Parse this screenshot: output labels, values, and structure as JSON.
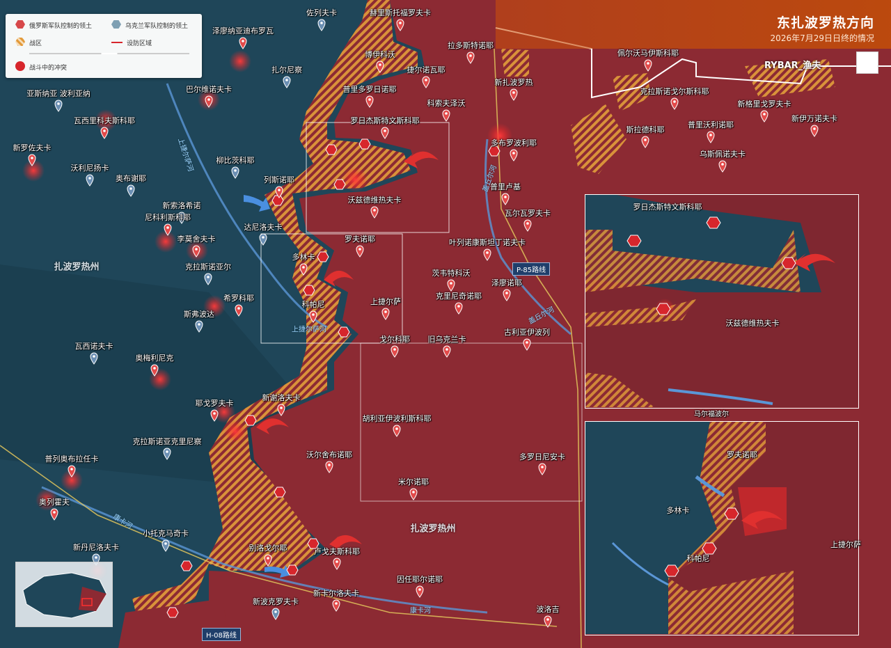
{
  "header": {
    "title": "东扎波罗热方向",
    "subtitle": "2026年7月29日日终的情况",
    "brand": "RYBAR_渔夫"
  },
  "legend": {
    "russian_control": "俄罗斯军队控制的领土",
    "ukrainian_control": "乌克兰军队控制的领土",
    "battle_zone": "战区",
    "defense_area": "设防区域",
    "clash": "战斗中的冲突"
  },
  "colors": {
    "russian": "#8c2a33",
    "ukrainian": "#1f4659",
    "battle_zone": "#d9923a",
    "clash": "#d7262c",
    "title_bg": "#c8500e"
  },
  "regions": [
    {
      "text": "扎波罗热州"
    },
    {
      "text": "扎波罗热州"
    }
  ],
  "rivers": [
    {
      "text": "上捷尔萨河"
    },
    {
      "text": "上捷尔萨河"
    },
    {
      "text": "盖丘尔河"
    },
    {
      "text": "盖丘尔河"
    },
    {
      "text": "康卡河"
    },
    {
      "text": "康卡河"
    }
  ],
  "roads": [
    {
      "text": "P-85路线"
    },
    {
      "text": "H-08路线"
    }
  ],
  "places": [
    {
      "name": "佐列夫卡"
    },
    {
      "name": "赫里斯托福罗夫卡"
    },
    {
      "name": "泽廖纳亚迪布罗瓦"
    },
    {
      "name": "博伊科沃"
    },
    {
      "name": "拉多斯特诺耶"
    },
    {
      "name": "捷尔诺瓦耶"
    },
    {
      "name": "扎尔尼察"
    },
    {
      "name": "新扎波罗热"
    },
    {
      "name": "巴尔维诺夫卡"
    },
    {
      "name": "普里多罗日诺耶"
    },
    {
      "name": "亚斯纳亚 波利亚纳"
    },
    {
      "name": "科索夫泽沃"
    },
    {
      "name": "瓦西里科夫斯科耶"
    },
    {
      "name": "罗日杰斯特文斯科耶"
    },
    {
      "name": "多布罗波利耶"
    },
    {
      "name": "新罗佐夫卡"
    },
    {
      "name": "柳比茨科耶"
    },
    {
      "name": "沃利尼扬卡"
    },
    {
      "name": "奥布谢耶"
    },
    {
      "name": "列斯诺耶"
    },
    {
      "name": "普里卢基"
    },
    {
      "name": "新索洛希诺"
    },
    {
      "name": "沃兹德维热夫卡"
    },
    {
      "name": "尼科利斯科耶"
    },
    {
      "name": "瓦尔瓦罗夫卡"
    },
    {
      "name": "达尼洛夫卡"
    },
    {
      "name": "李莫舍夫卡"
    },
    {
      "name": "罗夫诺耶"
    },
    {
      "name": "叶列诺康斯坦丁诺夫卡"
    },
    {
      "name": "多林卡"
    },
    {
      "name": "克拉斯诺亚尔"
    },
    {
      "name": "茨韦特科沃"
    },
    {
      "name": "泽廖诺耶"
    },
    {
      "name": "希罗科耶"
    },
    {
      "name": "科帕尼"
    },
    {
      "name": "上捷尔萨"
    },
    {
      "name": "克里尼奇诺耶"
    },
    {
      "name": "斯弗波达"
    },
    {
      "name": "古利亚伊波列"
    },
    {
      "name": "戈尔科耶"
    },
    {
      "name": "旧乌克兰卡"
    },
    {
      "name": "瓦西诺夫卡"
    },
    {
      "name": "奥梅利尼克"
    },
    {
      "name": "新谢洛夫卡"
    },
    {
      "name": "耶戈罗夫卡"
    },
    {
      "name": "胡利亚伊波利斯科耶"
    },
    {
      "name": "克拉斯诺亚克里尼察"
    },
    {
      "name": "沃尔舍布诺耶"
    },
    {
      "name": "多罗日尼安卡"
    },
    {
      "name": "普列奥布拉任卡"
    },
    {
      "name": "米尔诺耶"
    },
    {
      "name": "奥列霍夫"
    },
    {
      "name": "小托克马奇卡"
    },
    {
      "name": "新丹尼洛夫卡"
    },
    {
      "name": "别洛戈尔耶"
    },
    {
      "name": "卢戈夫斯科耶"
    },
    {
      "name": "因任耶尔诺耶"
    },
    {
      "name": "新卡尔洛夫卡"
    },
    {
      "name": "新波克罗夫卡"
    },
    {
      "name": "波洛吉"
    },
    {
      "name": "佩尔沃马伊斯科耶"
    },
    {
      "name": "克拉斯诺戈尔斯科耶"
    },
    {
      "name": "新格里戈罗夫卡"
    },
    {
      "name": "新伊万诺夫卡"
    },
    {
      "name": "斯拉德科耶"
    },
    {
      "name": "普里沃利诺耶"
    },
    {
      "name": "乌斯佩诺夫卡"
    }
  ],
  "inset_top": {
    "places": [
      {
        "name": "罗日杰斯特文斯科耶"
      },
      {
        "name": "沃兹德维热夫卡"
      }
    ]
  },
  "inset_bottom": {
    "caption": "马尔福波尔",
    "places": [
      {
        "name": "罗夫诺耶"
      },
      {
        "name": "多林卡"
      },
      {
        "name": "科帕尼"
      },
      {
        "name": "上捷尔萨"
      }
    ]
  }
}
